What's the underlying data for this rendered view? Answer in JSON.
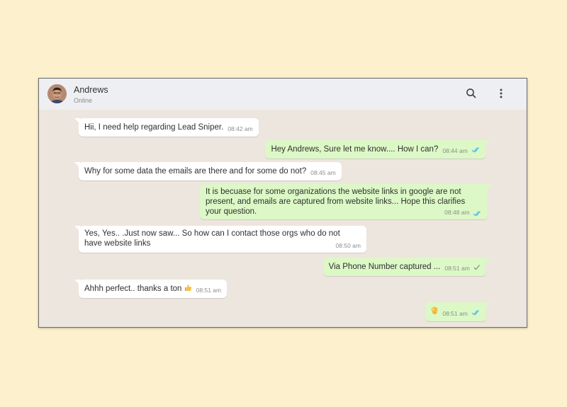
{
  "header": {
    "contact_name": "Andrews",
    "contact_status": "Online"
  },
  "messages": [
    {
      "dir": "in",
      "text": "Hii, I need help regarding Lead Sniper.",
      "time": "08:42 am"
    },
    {
      "dir": "out",
      "text": "Hey Andrews, Sure let me know.... How I can?",
      "time": "08:44 am",
      "status": "read"
    },
    {
      "dir": "in",
      "text": "Why for some data the emails are there and for some do not?",
      "time": "08:45 am"
    },
    {
      "dir": "out",
      "text": "It is becuase for some organizations the website links in google are not present, and emails are captured from website links... Hope this clarifies your question.",
      "time": "08:48 am",
      "status": "read"
    },
    {
      "dir": "in",
      "text": "Yes, Yes.. .Just now saw... So how can I contact those orgs who do not have website links",
      "time": "08:50 am"
    },
    {
      "dir": "out",
      "text": "Via Phone Number captured ...",
      "time": "08:51 am",
      "status": "sent"
    },
    {
      "dir": "in",
      "text": "Ahhh perfect.. thanks a ton",
      "time": "08:51 am"
    },
    {
      "dir": "out",
      "text": "",
      "time": "08:51 am",
      "status": "read"
    }
  ],
  "colors": {
    "page_background": "#fdf1cd",
    "chat_background": "#ede6de",
    "outgoing_bubble": "#dcf8c6",
    "incoming_bubble": "#ffffff",
    "read_ticks": "#4fb6ec",
    "sent_tick": "#8d8d8d"
  },
  "icons": [
    "search-icon",
    "more-vertical-icon",
    "thumbs-up-emoji-icon",
    "ok-hand-emoji-icon",
    "double-check-icon",
    "single-check-icon"
  ]
}
